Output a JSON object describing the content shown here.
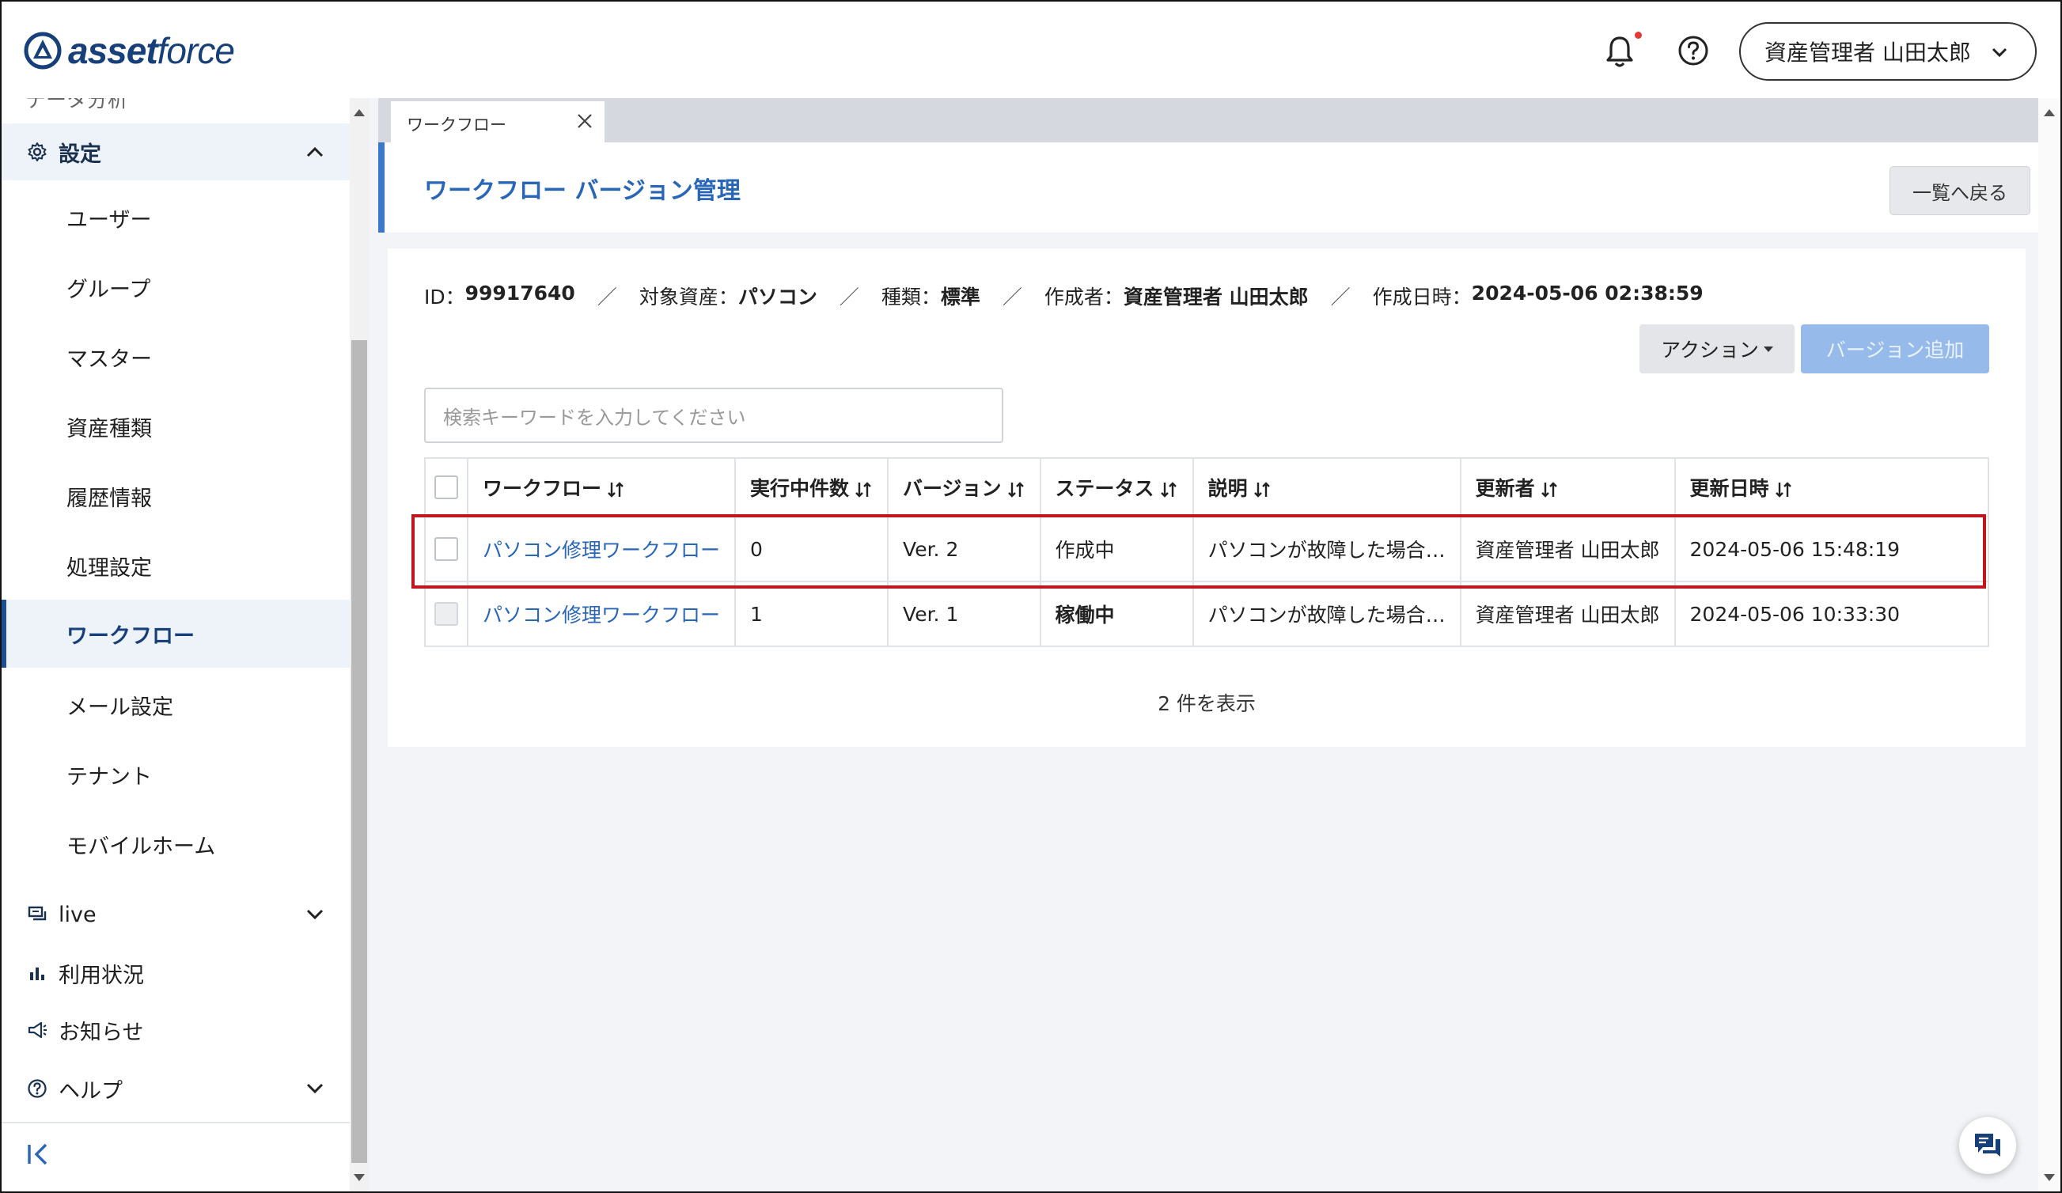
{
  "header": {
    "logo_prefix": "asset",
    "logo_suffix": "force",
    "user_label": "資産管理者 山田太郎"
  },
  "sidebar": {
    "clipped_item": "データ分析",
    "settings_label": "設定",
    "settings_items": [
      {
        "label": "ユーザー"
      },
      {
        "label": "グループ"
      },
      {
        "label": "マスター"
      },
      {
        "label": "資産種類"
      },
      {
        "label": "履歴情報"
      },
      {
        "label": "処理設定"
      },
      {
        "label": "ワークフロー",
        "active": true
      },
      {
        "label": "メール設定"
      },
      {
        "label": "テナント"
      },
      {
        "label": "モバイルホーム"
      }
    ],
    "live_label": "live",
    "usage_label": "利用状況",
    "notice_label": "お知らせ",
    "help_label": "ヘルプ"
  },
  "tab": {
    "label": "ワークフロー"
  },
  "page": {
    "title": "ワークフロー バージョン管理",
    "back_label": "一覧へ戻る"
  },
  "meta": {
    "id_label": "ID：",
    "id_value": "99917640",
    "asset_label": "対象資産：",
    "asset_value": "パソコン",
    "kind_label": "種類：",
    "kind_value": "標準",
    "creator_label": "作成者：",
    "creator_value": "資産管理者 山田太郎",
    "created_label": "作成日時：",
    "created_value": "2024-05-06 02:38:59",
    "separator": "／"
  },
  "toolbar": {
    "action_label": "アクション",
    "add_version_label": "バージョン追加",
    "search_placeholder": "検索キーワードを入力してください"
  },
  "table": {
    "columns": [
      "ワークフロー",
      "実行中件数",
      "バージョン",
      "ステータス",
      "説明",
      "更新者",
      "更新日時"
    ],
    "rows": [
      {
        "workflow": "パソコン修理ワークフロー",
        "running": "0",
        "version": "Ver. 2",
        "status": "作成中",
        "description": "パソコンが故障した場合…",
        "updater": "資産管理者 山田太郎",
        "updated_at": "2024-05-06 15:48:19"
      },
      {
        "workflow": "パソコン修理ワークフロー",
        "running": "1",
        "version": "Ver. 1",
        "status": "稼働中",
        "description": "パソコンが故障した場合…",
        "updater": "資産管理者 山田太郎",
        "updated_at": "2024-05-06 10:33:30"
      }
    ]
  },
  "footer": {
    "count_label": "2 件を表示"
  },
  "colors": {
    "brand": "#17407a",
    "link": "#2a66b8",
    "highlight": "#c0161e",
    "primary_disabled": "#96bbea"
  }
}
